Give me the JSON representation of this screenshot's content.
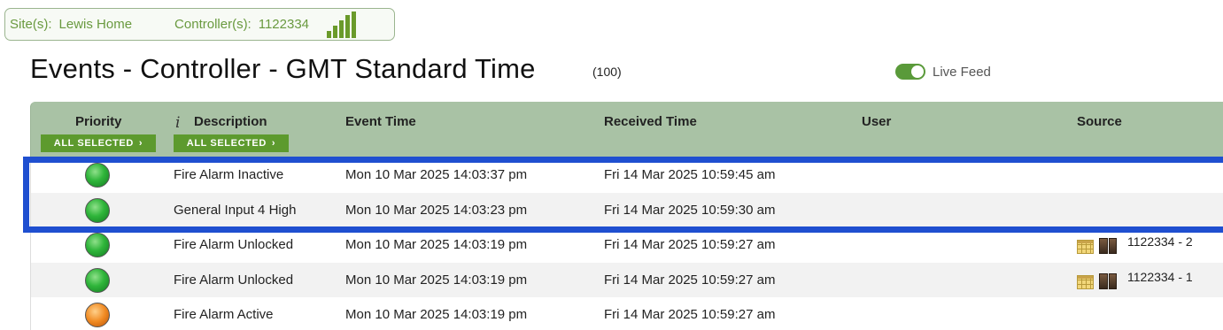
{
  "site_bar": {
    "site_label": "Site(s):",
    "site_value": "Lewis Home",
    "controller_label": "Controller(s):",
    "controller_value": "1122334",
    "signal_icon": "signal-strength-icon"
  },
  "header": {
    "title": "Events - Controller - GMT Standard Time",
    "count": "(100)",
    "live_feed_label": "Live Feed",
    "live_feed_on": true
  },
  "table": {
    "columns": {
      "priority": "Priority",
      "description": "Description",
      "event_time": "Event Time",
      "received_time": "Received Time",
      "user": "User",
      "source": "Source"
    },
    "filters": {
      "priority": "ALL SELECTED",
      "description": "ALL SELECTED"
    },
    "rows": [
      {
        "priority": "green",
        "description": "Fire Alarm Inactive",
        "event_time": "Mon 10 Mar 2025 14:03:37 pm",
        "received_time": "Fri 14 Mar 2025 10:59:45 am",
        "user": "",
        "source": ""
      },
      {
        "priority": "green",
        "description": "General Input 4 High",
        "event_time": "Mon 10 Mar 2025 14:03:23 pm",
        "received_time": "Fri 14 Mar 2025 10:59:30 am",
        "user": "",
        "source": ""
      },
      {
        "priority": "green",
        "description": "Fire Alarm Unlocked",
        "event_time": "Mon 10 Mar 2025 14:03:19 pm",
        "received_time": "Fri 14 Mar 2025 10:59:27 am",
        "user": "",
        "source": "1122334 - 2"
      },
      {
        "priority": "green",
        "description": "Fire Alarm Unlocked",
        "event_time": "Mon 10 Mar 2025 14:03:19 pm",
        "received_time": "Fri 14 Mar 2025 10:59:27 am",
        "user": "",
        "source": "1122334 - 1"
      },
      {
        "priority": "orange",
        "description": "Fire Alarm Active",
        "event_time": "Mon 10 Mar 2025 14:03:19 pm",
        "received_time": "Fri 14 Mar 2025 10:59:27 am",
        "user": "",
        "source": ""
      }
    ]
  },
  "colors": {
    "accent_green": "#5d9a2e",
    "header_bg": "#a9c2a5",
    "highlight_blue": "#1f4fd0",
    "priority_green": "#2fb53a",
    "priority_orange": "#f08a22"
  }
}
